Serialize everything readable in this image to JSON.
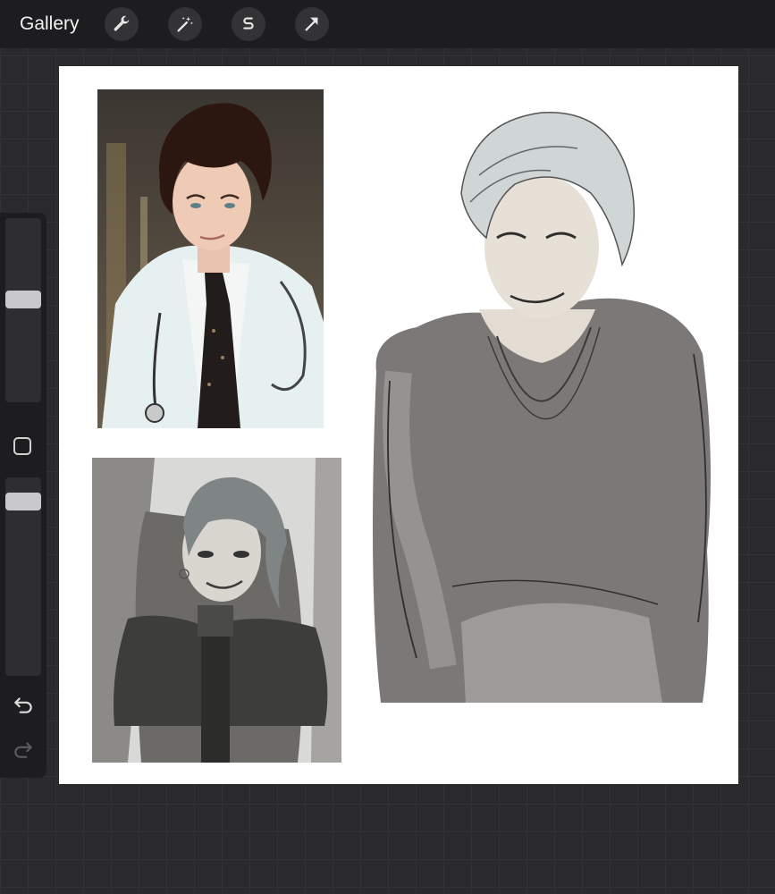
{
  "topbar": {
    "gallery_label": "Gallery",
    "tools": [
      {
        "name": "actions",
        "icon": "wrench-icon"
      },
      {
        "name": "adjustments",
        "icon": "magic-wand-icon"
      },
      {
        "name": "selection",
        "icon": "selection-s-icon"
      },
      {
        "name": "transform",
        "icon": "arrow-cursor-icon"
      }
    ]
  },
  "sidebar": {
    "brush_size_level": 0.55,
    "opacity_level": 0.95,
    "icons": [
      "modify-square-icon",
      "undo-icon",
      "redo-icon"
    ]
  },
  "canvas": {
    "background": "#ffffff",
    "items": [
      "reference-photo",
      "reference-illustration",
      "character-sketch"
    ]
  },
  "colors": {
    "app_background": "#2a2a2c",
    "bar": "#1d1d1f",
    "button": "#333335",
    "icon": "#e8e8e8"
  }
}
